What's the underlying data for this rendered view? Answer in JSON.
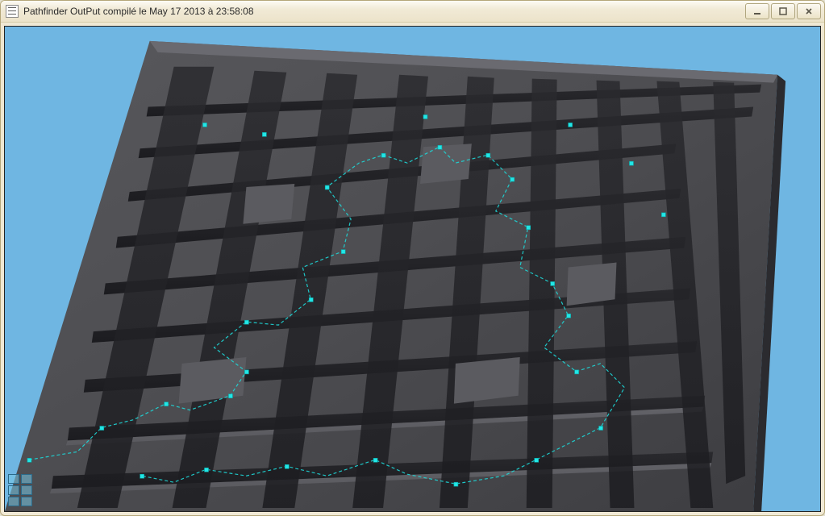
{
  "window": {
    "title": "Pathfinder OutPut compilé le May 17 2013 à 23:58:08"
  },
  "colors": {
    "sky": "#6fb6e2",
    "maze_top": "#4e4e52",
    "maze_wall_light": "#7c7c80",
    "maze_wall_dark": "#2e2e32",
    "path_stroke": "#1ed8d8",
    "node_fill": "#22e6e6"
  },
  "scene": {
    "description": "3D perspective render of a large square grey extruded maze on a sky-blue background. A cyan dotted polyline with small square waypoint markers shows a computed path through corridors."
  }
}
